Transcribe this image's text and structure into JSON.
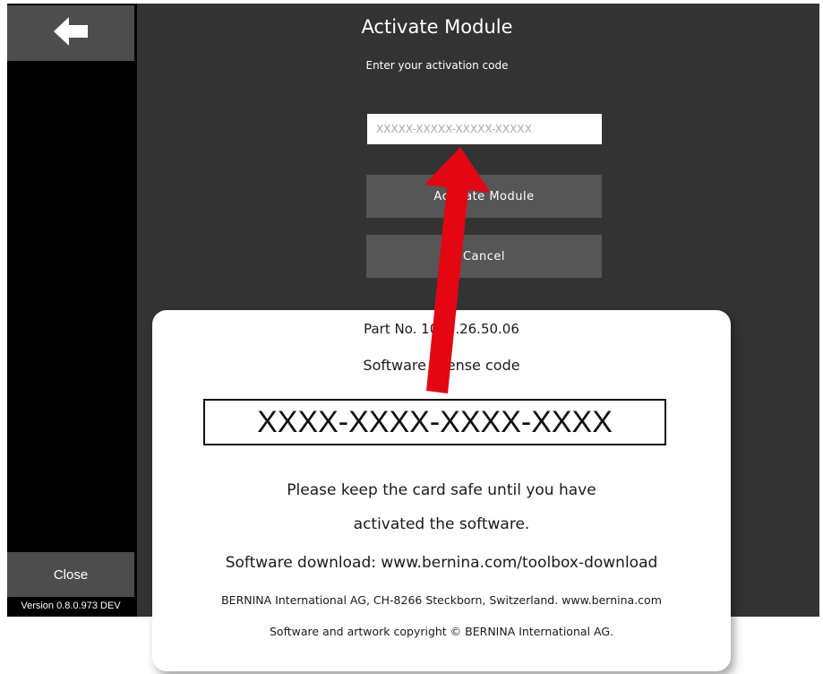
{
  "sidebar": {
    "back_icon": "arrow-left-icon",
    "close_label": "Close",
    "version": "Version 0.8.0.973 DEV"
  },
  "dialog": {
    "title": "Activate Module",
    "subtitle": "Enter your activation code",
    "code_placeholder": "XXXXX-XXXXX-XXXXX-XXXXX",
    "code_value": "",
    "activate_label": "Activate Module",
    "cancel_label": "Cancel"
  },
  "card": {
    "part_no": "Part No. 1026.26.50.06",
    "license_label": "Software license code",
    "license_code": "XXXX-XXXX-XXXX-XXXX",
    "keep_line1": "Please keep the card safe until you have",
    "keep_line2": "activated the software.",
    "download": "Software download: www.bernina.com/toolbox-download",
    "company": "BERNINA International AG, CH-8266 Steckborn, Switzerland. www.bernina.com",
    "copyright": "Software and artwork copyright © BERNINA International AG."
  },
  "colors": {
    "main_bg": "#333333",
    "button_bg": "#565656",
    "sidebar_bg": "#000000",
    "arrow": "#e30613"
  }
}
